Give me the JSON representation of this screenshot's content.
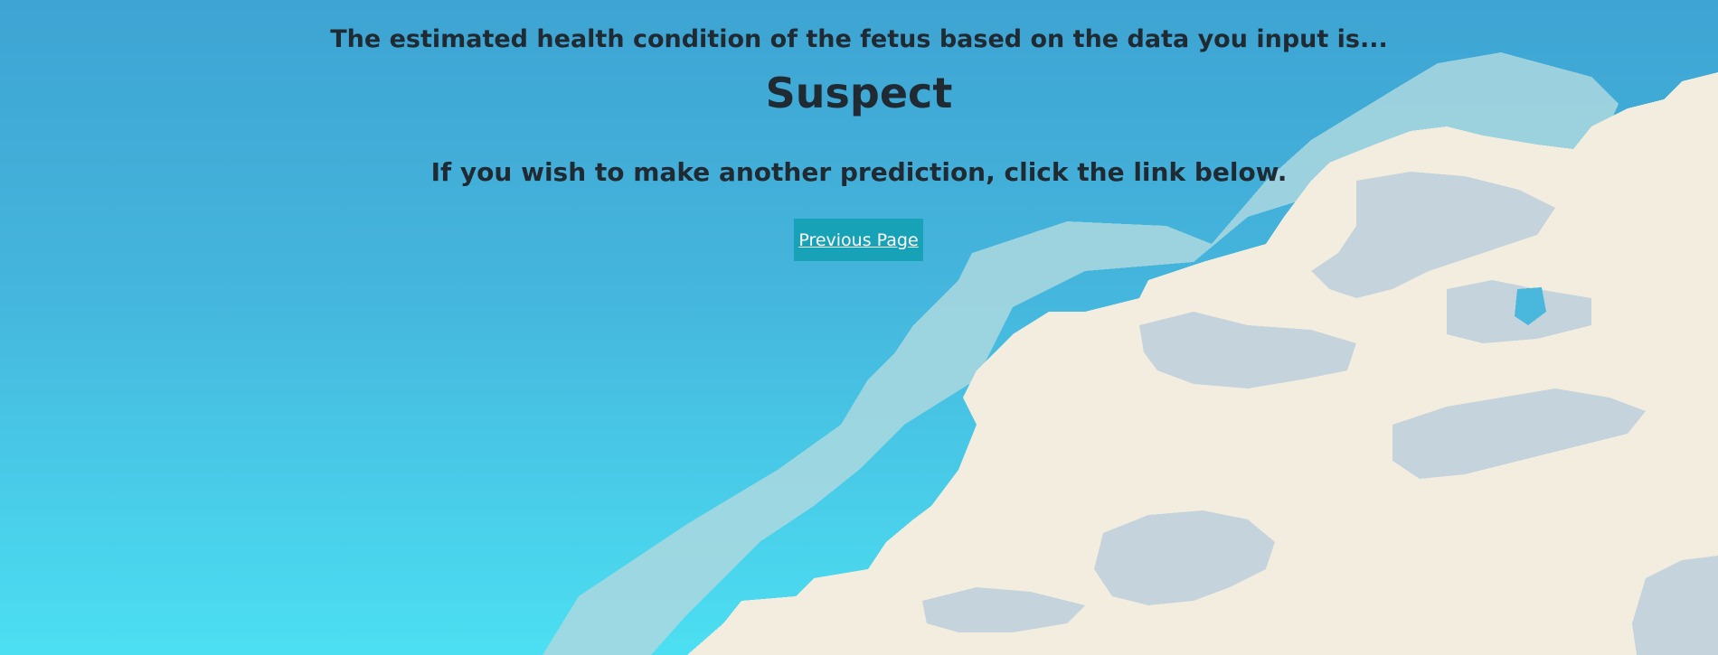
{
  "page": {
    "intro_text": "The estimated health condition of the fetus based on the data you input is...",
    "result_label": "Suspect",
    "hint_text": "If you wish to make another prediction, click the link below.",
    "previous_page_label": "Previous Page"
  },
  "colors": {
    "sky_top": "#3ea4d3",
    "sky_bottom": "#4cdff2",
    "cloud_light": "#f3ede0",
    "cloud_shadow": "#c5d3dc",
    "cloud_haze": "#acd8df",
    "button_bg": "#17a2b8",
    "text_dark": "#1f2a33"
  }
}
